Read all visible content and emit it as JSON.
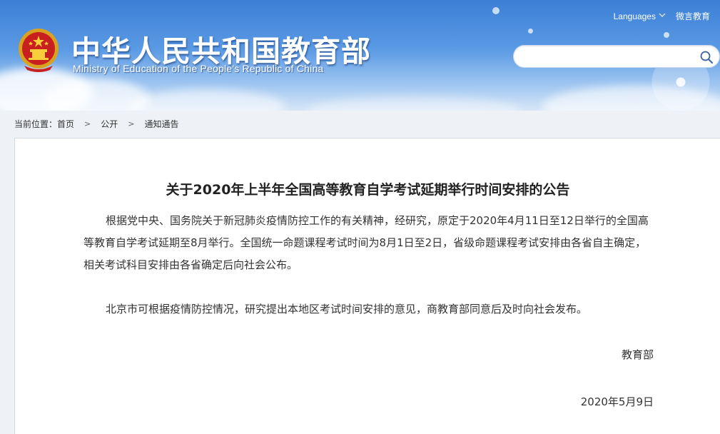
{
  "header": {
    "title": "中华人民共和国教育部",
    "subtitle": "Ministry of Education of the People's Republic of China",
    "languages_label": "Languages",
    "weibo_label": "微言教育",
    "search": {
      "placeholder": "",
      "value": ""
    }
  },
  "breadcrumb": {
    "prefix": "当前位置：",
    "items": [
      {
        "label": "首页"
      },
      {
        "label": "公开"
      },
      {
        "label": "通知通告"
      }
    ],
    "separator": ">"
  },
  "article": {
    "title": "关于2020年上半年全国高等教育自学考试延期举行时间安排的公告",
    "paragraphs": [
      "根据党中央、国务院关于新冠肺炎疫情防控工作的有关精神，经研究，原定于2020年4月11日至12日举行的全国高等教育自学考试延期至8月举行。全国统一命题课程考试时间为8月1日至2日，省级命题课程考试安排由各省自主确定，相关考试科目安排由各省确定后向社会公布。",
      "北京市可根据疫情防控情况，研究提出本地区考试时间安排的意见，商教育部同意后及时向社会发布。"
    ],
    "signature": "教育部",
    "date": "2020年5月9日"
  },
  "icons": {
    "emblem": "national-emblem-icon",
    "search": "search-icon",
    "chevron": "chevron-down-icon"
  },
  "colors": {
    "header_top": "#3b7fd6",
    "header_bottom": "#d7e6f7",
    "panel_bg": "#ffffff",
    "page_bg": "#eef1f6",
    "text": "#333333"
  }
}
